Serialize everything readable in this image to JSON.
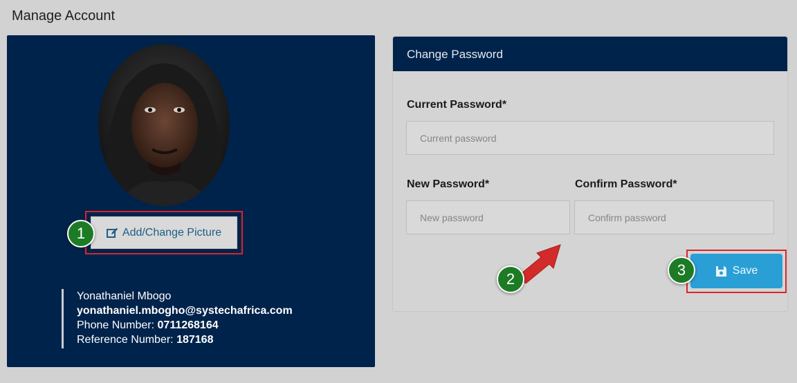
{
  "page": {
    "title": "Manage Account"
  },
  "profile": {
    "avatar_alt": "profile photo",
    "change_picture_label": "Add/Change Picture",
    "name": "Yonathaniel Mbogo",
    "email": "yonathaniel.mbogho@systechafrica.com",
    "phone_label": "Phone Number:",
    "phone": "0711268164",
    "reference_label": "Reference Number:",
    "reference": "187168"
  },
  "password_panel": {
    "title": "Change Password",
    "current_label": "Current Password*",
    "current_placeholder": "Current password",
    "current_value": "",
    "new_label": "New Password*",
    "new_placeholder": "New password",
    "new_value": "",
    "confirm_label": "Confirm Password*",
    "confirm_placeholder": "Confirm password",
    "confirm_value": "",
    "save_label": "Save"
  },
  "annotations": {
    "steps": [
      "1",
      "2",
      "3"
    ],
    "highlight_color": "#d8252b",
    "badge_color": "#1d7b26",
    "arrow_color": "#d22b2b"
  },
  "colors": {
    "navy": "#00234b",
    "save_button": "#2a9fd6",
    "background": "#d2d2d2"
  },
  "icons": {
    "change_picture": "edit-icon",
    "save": "floppy-disk-icon"
  }
}
